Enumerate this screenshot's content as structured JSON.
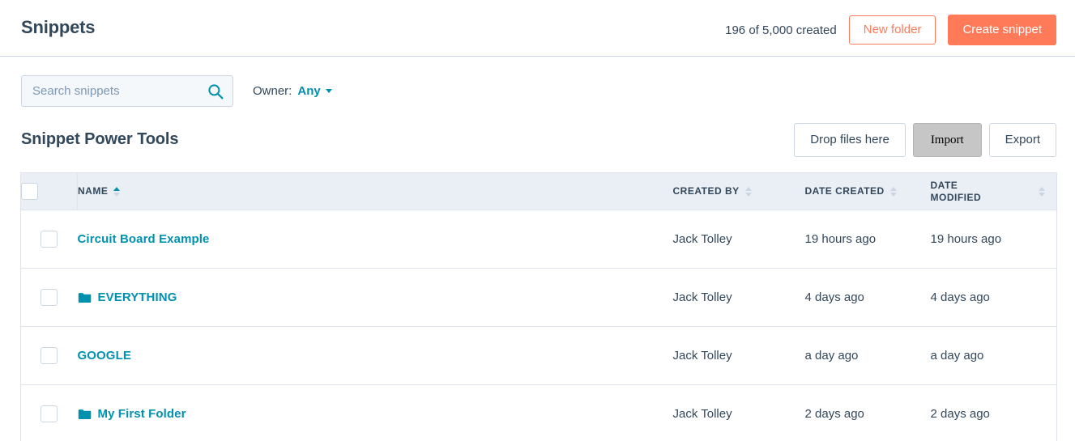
{
  "header": {
    "title": "Snippets",
    "created_count": "196 of 5,000 created",
    "new_folder_label": "New folder",
    "create_snippet_label": "Create snippet"
  },
  "filters": {
    "search_placeholder": "Search snippets",
    "search_value": "",
    "search_icon": "search-icon",
    "owner_label": "Owner:",
    "owner_value": "Any"
  },
  "section": {
    "title": "Snippet Power Tools",
    "drop_files_label": "Drop files here",
    "import_label": "Import",
    "export_label": "Export"
  },
  "table": {
    "columns": [
      {
        "key": "name",
        "label": "NAME",
        "sorted": "asc"
      },
      {
        "key": "created_by",
        "label": "CREATED BY",
        "sorted": "none"
      },
      {
        "key": "date_created",
        "label": "DATE CREATED",
        "sorted": "none"
      },
      {
        "key": "date_modified",
        "label": "DATE MODIFIED",
        "sorted": "none"
      }
    ],
    "rows": [
      {
        "name": "Circuit Board Example",
        "is_folder": false,
        "created_by": "Jack Tolley",
        "date_created": "19 hours ago",
        "date_modified": "19 hours ago",
        "checked": false
      },
      {
        "name": "EVERYTHING",
        "is_folder": true,
        "created_by": "Jack Tolley",
        "date_created": "4 days ago",
        "date_modified": "4 days ago",
        "checked": false
      },
      {
        "name": "GOOGLE",
        "is_folder": false,
        "created_by": "Jack Tolley",
        "date_created": "a day ago",
        "date_modified": "a day ago",
        "checked": false
      },
      {
        "name": "My First Folder",
        "is_folder": true,
        "created_by": "Jack Tolley",
        "date_created": "2 days ago",
        "date_modified": "2 days ago",
        "checked": false
      }
    ]
  },
  "colors": {
    "accent_orange": "#ff7a59",
    "accent_teal": "#0091ae",
    "text_dark": "#33475b",
    "border": "#cbd6e2",
    "table_header_bg": "#eaeff5",
    "search_bg": "#f5f8fa"
  }
}
